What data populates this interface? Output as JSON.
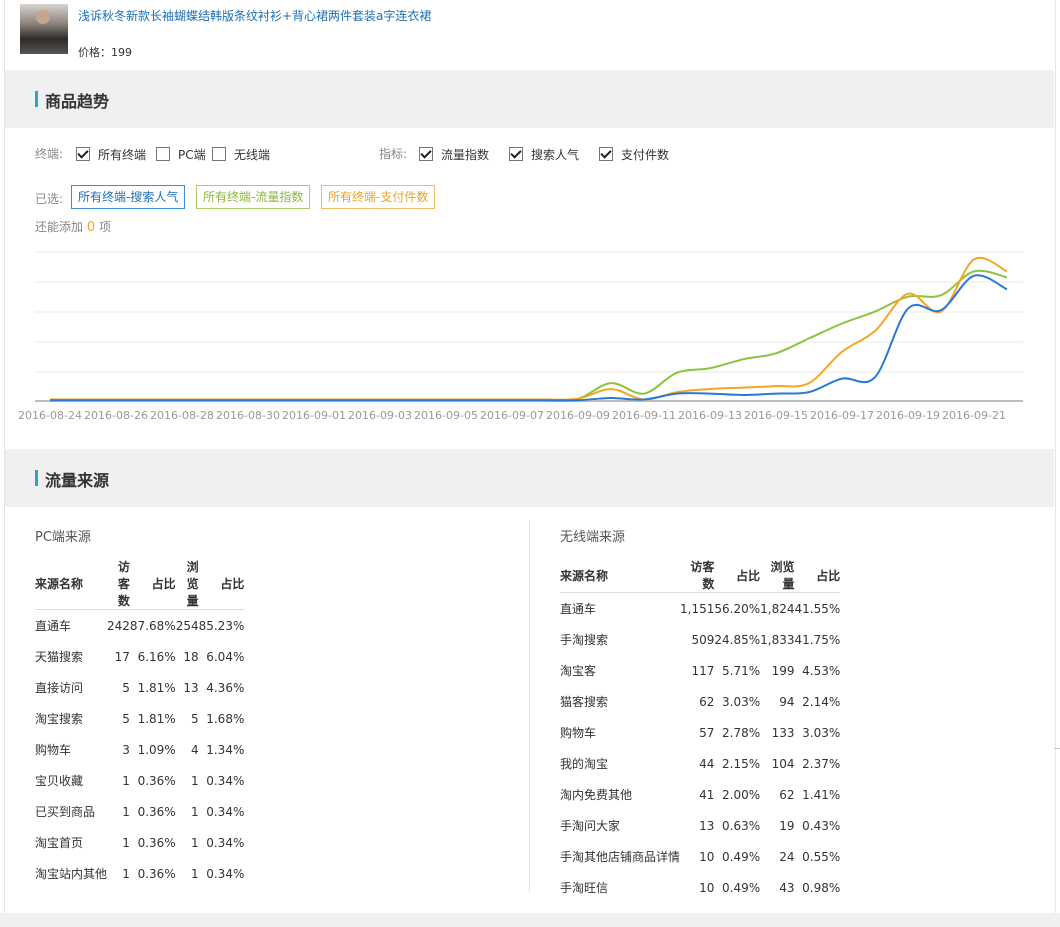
{
  "product": {
    "title": "浅诉秋冬新款长袖蝴蝶结韩版条纹衬衫+背心裙两件套装a字连衣裙",
    "price": "价格：199"
  },
  "trend": {
    "section_title": "商品趋势",
    "terminal_label": "终端:",
    "terminals": [
      {
        "label": "所有终端",
        "checked": true
      },
      {
        "label": "PC端",
        "checked": false
      },
      {
        "label": "无线端",
        "checked": false
      }
    ],
    "metric_label": "指标:",
    "metrics": [
      {
        "label": "流量指数",
        "checked": true
      },
      {
        "label": "搜索人气",
        "checked": true
      },
      {
        "label": "支付件数",
        "checked": true
      }
    ],
    "selected_label": "已选:",
    "selected_tags": [
      {
        "label": "所有终端-搜索人气",
        "color": "#1f6fb5"
      },
      {
        "label": "所有终端-流量指数",
        "color": "#8ab93a"
      },
      {
        "label": "所有终端-支付件数",
        "color": "#f0a31e"
      }
    ],
    "remaining_prefix": "还能添加",
    "remaining_count": "0",
    "remaining_suffix": "项"
  },
  "chart_data": {
    "type": "line",
    "x": [
      "2016-08-24",
      "2016-08-25",
      "2016-08-26",
      "2016-08-27",
      "2016-08-28",
      "2016-08-29",
      "2016-08-30",
      "2016-08-31",
      "2016-09-01",
      "2016-09-02",
      "2016-09-03",
      "2016-09-04",
      "2016-09-05",
      "2016-09-06",
      "2016-09-07",
      "2016-09-08",
      "2016-09-09",
      "2016-09-10",
      "2016-09-11",
      "2016-09-12",
      "2016-09-13",
      "2016-09-14",
      "2016-09-15",
      "2016-09-16",
      "2016-09-17",
      "2016-09-18",
      "2016-09-19",
      "2016-09-20",
      "2016-09-21",
      "2016-09-22"
    ],
    "x_tick_labels": [
      "2016-08-24",
      "2016-08-26",
      "2016-08-28",
      "2016-08-30",
      "2016-09-01",
      "2016-09-03",
      "2016-09-05",
      "2016-09-07",
      "2016-09-09",
      "2016-09-11",
      "2016-09-13",
      "2016-09-15",
      "2016-09-17",
      "2016-09-19",
      "2016-09-21"
    ],
    "ylim": [
      0,
      100
    ],
    "grid": true,
    "legend": "none",
    "series": [
      {
        "color": "#8ac43f",
        "values": [
          0.5,
          0.5,
          0.5,
          0.5,
          0.5,
          0.5,
          0.5,
          0.5,
          0.5,
          0.5,
          0.5,
          0.5,
          0.5,
          0.5,
          0.5,
          0.5,
          1.5,
          12,
          5,
          19,
          22,
          28,
          32,
          42,
          52,
          60,
          70,
          71,
          87,
          83
        ]
      },
      {
        "color": "#f5a623",
        "values": [
          1,
          1,
          1,
          1,
          1,
          1,
          1,
          1,
          1,
          1,
          1,
          1,
          1,
          1,
          1,
          1,
          1.5,
          8,
          1,
          6,
          8,
          9,
          10,
          12,
          33,
          47,
          72,
          60,
          95,
          87
        ]
      },
      {
        "color": "#2a78d6",
        "values": [
          0.5,
          0.5,
          0.5,
          0.5,
          0.5,
          0.5,
          0.5,
          0.5,
          0.5,
          0.5,
          0.5,
          0.5,
          0.5,
          0.5,
          0.5,
          0.5,
          0.5,
          2,
          1,
          5,
          5,
          4,
          5,
          6,
          15,
          16,
          62,
          61,
          84,
          75
        ]
      }
    ]
  },
  "traffic": {
    "section_title": "流量来源",
    "pc": {
      "title": "PC端来源",
      "headers": [
        "来源名称",
        "访客数",
        "占比",
        "浏览量",
        "占比"
      ],
      "rows": [
        [
          "直通车",
          "242",
          "87.68%",
          "254",
          "85.23%"
        ],
        [
          "天猫搜索",
          "17",
          "6.16%",
          "18",
          "6.04%"
        ],
        [
          "直接访问",
          "5",
          "1.81%",
          "13",
          "4.36%"
        ],
        [
          "淘宝搜索",
          "5",
          "1.81%",
          "5",
          "1.68%"
        ],
        [
          "购物车",
          "3",
          "1.09%",
          "4",
          "1.34%"
        ],
        [
          "宝贝收藏",
          "1",
          "0.36%",
          "1",
          "0.34%"
        ],
        [
          "已买到商品",
          "1",
          "0.36%",
          "1",
          "0.34%"
        ],
        [
          "淘宝首页",
          "1",
          "0.36%",
          "1",
          "0.34%"
        ],
        [
          "淘宝站内其他",
          "1",
          "0.36%",
          "1",
          "0.34%"
        ]
      ]
    },
    "mobile": {
      "title": "无线端来源",
      "headers": [
        "来源名称",
        "访客数",
        "占比",
        "浏览量",
        "占比"
      ],
      "rows": [
        [
          "直通车",
          "1,151",
          "56.20%",
          "1,824",
          "41.55%"
        ],
        [
          "手淘搜索",
          "509",
          "24.85%",
          "1,833",
          "41.75%"
        ],
        [
          "淘宝客",
          "117",
          "5.71%",
          "199",
          "4.53%"
        ],
        [
          "猫客搜索",
          "62",
          "3.03%",
          "94",
          "2.14%"
        ],
        [
          "购物车",
          "57",
          "2.78%",
          "133",
          "3.03%"
        ],
        [
          "我的淘宝",
          "44",
          "2.15%",
          "104",
          "2.37%"
        ],
        [
          "淘内免费其他",
          "41",
          "2.00%",
          "62",
          "1.41%"
        ],
        [
          "手淘问大家",
          "13",
          "0.63%",
          "19",
          "0.43%"
        ],
        [
          "手淘其他店铺商品详情",
          "10",
          "0.49%",
          "24",
          "0.55%"
        ],
        [
          "手淘旺信",
          "10",
          "0.49%",
          "43",
          "0.98%"
        ]
      ]
    }
  }
}
